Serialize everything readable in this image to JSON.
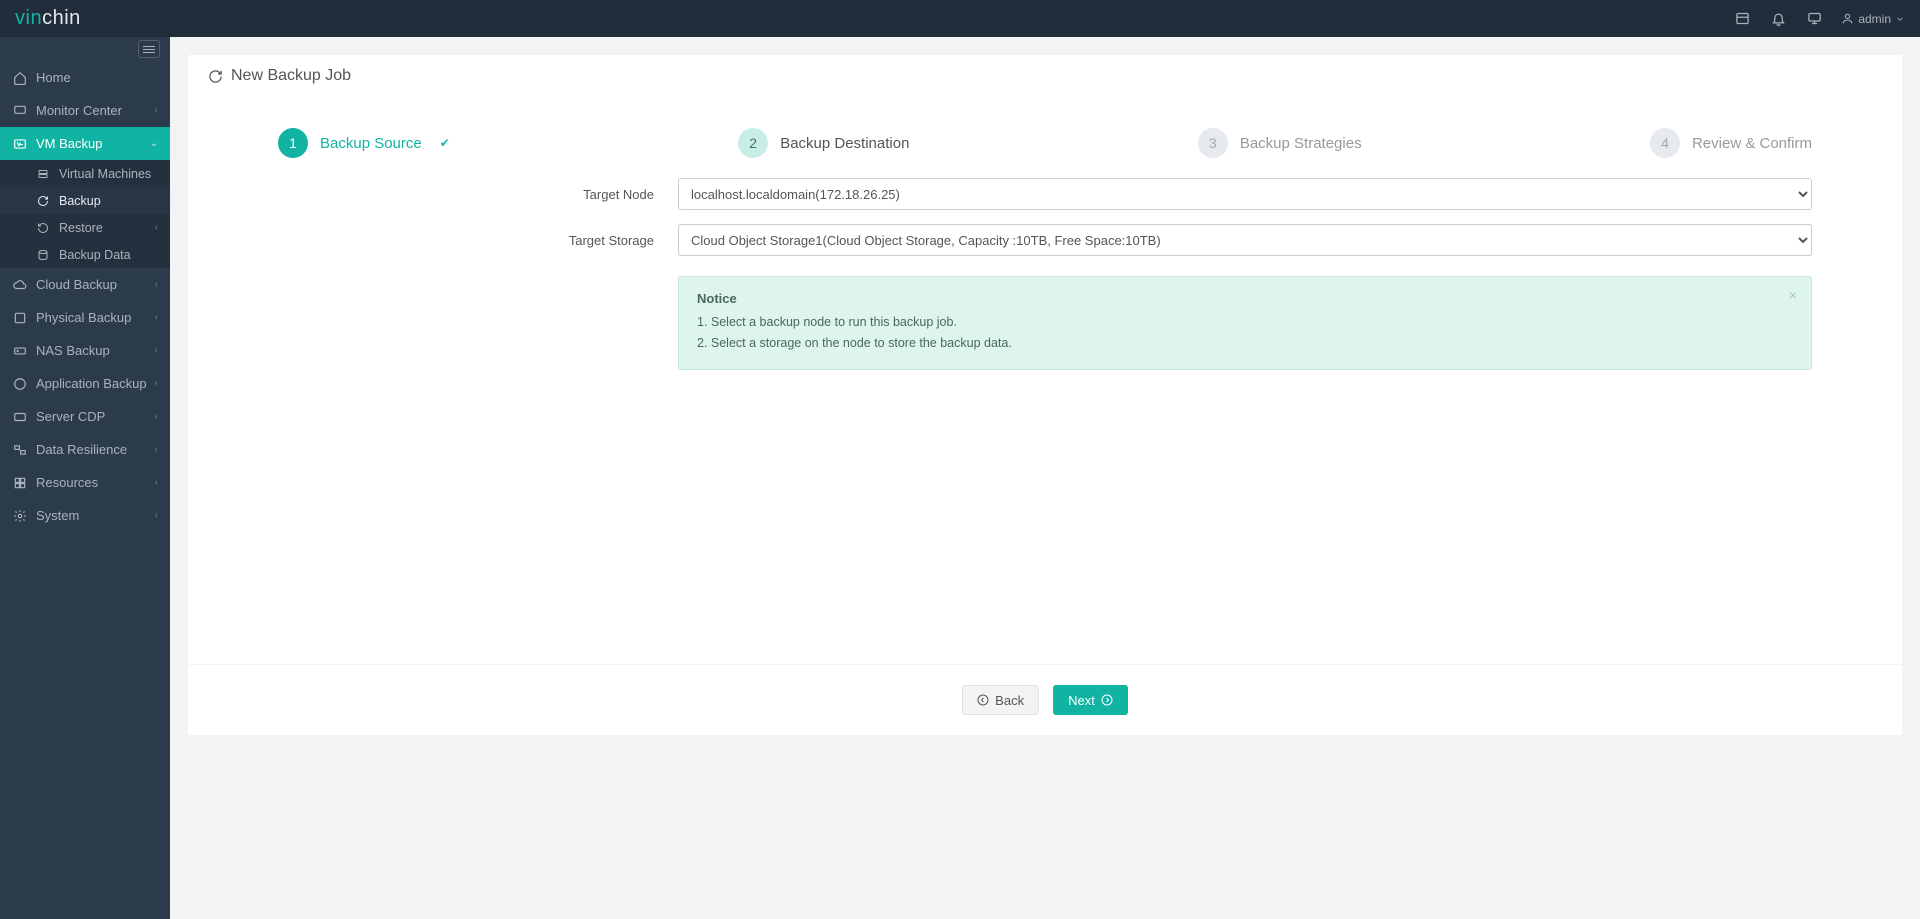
{
  "brand": {
    "part1": "vin",
    "part2": "chin"
  },
  "topbar": {
    "user": "admin"
  },
  "sidebar": {
    "items": [
      {
        "label": "Home"
      },
      {
        "label": "Monitor Center"
      },
      {
        "label": "VM Backup",
        "children": [
          {
            "label": "Virtual Machines"
          },
          {
            "label": "Backup"
          },
          {
            "label": "Restore"
          },
          {
            "label": "Backup Data"
          }
        ]
      },
      {
        "label": "Cloud Backup"
      },
      {
        "label": "Physical Backup"
      },
      {
        "label": "NAS Backup"
      },
      {
        "label": "Application Backup"
      },
      {
        "label": "Server CDP"
      },
      {
        "label": "Data Resilience"
      },
      {
        "label": "Resources"
      },
      {
        "label": "System"
      }
    ]
  },
  "page": {
    "title": "New Backup Job"
  },
  "steps": [
    {
      "num": "1",
      "label": "Backup Source"
    },
    {
      "num": "2",
      "label": "Backup Destination"
    },
    {
      "num": "3",
      "label": "Backup Strategies"
    },
    {
      "num": "4",
      "label": "Review & Confirm"
    }
  ],
  "form": {
    "targetNodeLabel": "Target Node",
    "targetNodeValue": "localhost.localdomain(172.18.26.25)",
    "targetStorageLabel": "Target Storage",
    "targetStorageValue": "Cloud Object Storage1(Cloud Object Storage, Capacity :10TB, Free Space:10TB)"
  },
  "notice": {
    "title": "Notice",
    "line1": "1. Select a backup node to run this backup job.",
    "line2": "2. Select a storage on the node to store the backup data."
  },
  "buttons": {
    "back": "Back",
    "next": "Next"
  }
}
